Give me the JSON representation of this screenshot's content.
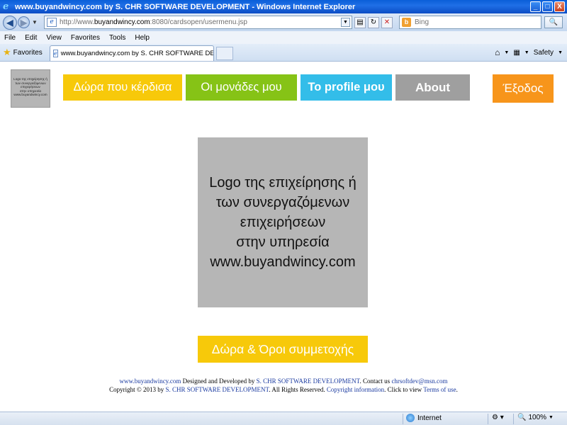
{
  "window": {
    "title": "www.buyandwincy.com by S. CHR SOFTWARE DEVELOPMENT - Windows Internet Explorer",
    "minimize": "_",
    "maximize": "□",
    "close": "X"
  },
  "address": {
    "url_prefix": "http://www.",
    "url_domain": "buyandwincy.com",
    "url_suffix": ":8080/cardsopen/usermenu.jsp",
    "search_placeholder": "Bing"
  },
  "menu": {
    "items": [
      "File",
      "Edit",
      "View",
      "Favorites",
      "Tools",
      "Help"
    ]
  },
  "favorites_bar": {
    "favorites_label": "Favorites",
    "tab_title": "www.buyandwincy.com by S. CHR SOFTWARE DEVEL...",
    "safety_label": "Safety"
  },
  "small_logo": {
    "lines": [
      "Logo της επιχείρησης ή",
      "των συνεργαζόμενων",
      "επιχειρήσεων",
      "στην υπηρεσία",
      "www.buyandwincy.com"
    ]
  },
  "nav": {
    "gifts_won": "Δώρα που κέρδισα",
    "my_points": "Οι μονάδες μου",
    "profile": "Το profile μου",
    "about": "About",
    "exit": "Έξοδος"
  },
  "big_logo": {
    "lines": [
      "Logo της επιχείρησης ή",
      "των συνεργαζόμενων",
      "επιχειρήσεων",
      "στην υπηρεσία",
      "www.buyandwincy.com"
    ]
  },
  "terms_button": "Δώρα & Όροι συμμετοχής",
  "footer": {
    "site_link": "www.buyandwincy.com",
    "designed_by": " Designed and Developed by ",
    "company_link": "S. CHR SOFTWARE DEVELOPMENT",
    "contact": ". Contact us ",
    "email_link": "chrsoftdev@msn.com",
    "copyright_prefix": "Copyright © 2013 by ",
    "company_link2": "S. CHR SOFTWARE DEVELOPMENT",
    "rights": ". All Rights Reserved. ",
    "copyright_info_link": "Copyright information",
    "click_to_view": ". Click to view ",
    "terms_link": "Terms of use",
    "end": "."
  },
  "statusbar": {
    "zone": "Internet",
    "zoom": "100%"
  }
}
